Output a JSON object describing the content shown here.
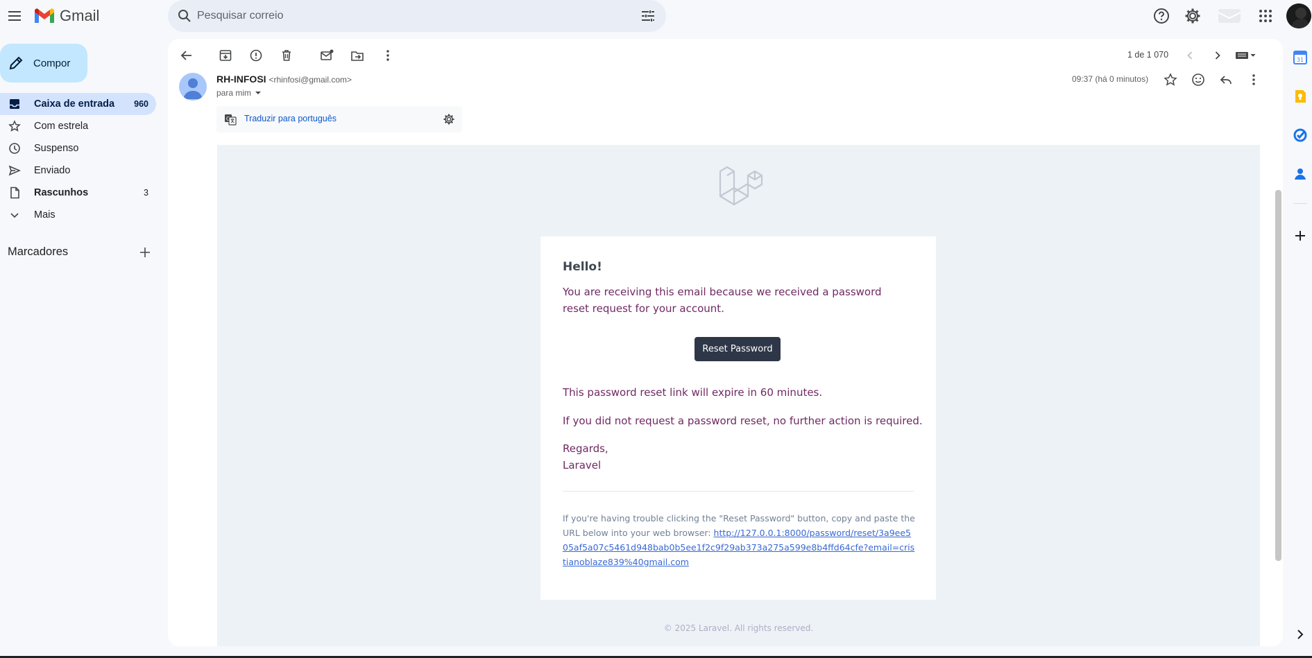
{
  "app": {
    "name": "Gmail"
  },
  "search": {
    "placeholder": "Pesquisar correio"
  },
  "compose": {
    "label": "Compor"
  },
  "sidebar": {
    "items": [
      {
        "label": "Caixa de entrada",
        "count": "960",
        "icon": "inbox-icon"
      },
      {
        "label": "Com estrela",
        "count": "",
        "icon": "star-icon"
      },
      {
        "label": "Suspenso",
        "count": "",
        "icon": "clock-icon"
      },
      {
        "label": "Enviado",
        "count": "",
        "icon": "send-icon"
      },
      {
        "label": "Rascunhos",
        "count": "3",
        "icon": "draft-icon"
      },
      {
        "label": "Mais",
        "count": "",
        "icon": "chevron-down-icon"
      }
    ],
    "labels_title": "Marcadores"
  },
  "toolbar": {
    "pager": "1 de 1 070"
  },
  "message": {
    "sender_name": "RH-INFOSI",
    "sender_email": "<rhinfosi@gmail.com>",
    "to": "para mim",
    "time": "09:37 (há 0 minutos)",
    "translate_label": "Traduzir para português"
  },
  "email": {
    "greeting": "Hello!",
    "line1": "You are receiving this email because we received a password reset request for your account.",
    "button": "Reset Password",
    "line2": "This password reset link will expire in 60 minutes.",
    "line3": "If you did not request a password reset, no further action is required.",
    "regards": "Regards,",
    "signature": "Laravel",
    "subcopy_text": "If you're having trouble clicking the \"Reset Password\" button, copy and paste the URL below into your web browser: ",
    "subcopy_link": "http://127.0.0.1:8000/password/reset/3a9ee505af5a07c5461d948bab0b5ee1f2c9f29ab373a275a599e8b4ffd64cfe?email=cristianoblaze839%40gmail.com",
    "footer": "© 2025 Laravel. All rights reserved."
  },
  "colors": {
    "accent": "#0b57d0",
    "compose_bg": "#c2e7ff",
    "active_nav": "#d3e3fd",
    "email_text": "#702963",
    "button_bg": "#2d3748"
  }
}
